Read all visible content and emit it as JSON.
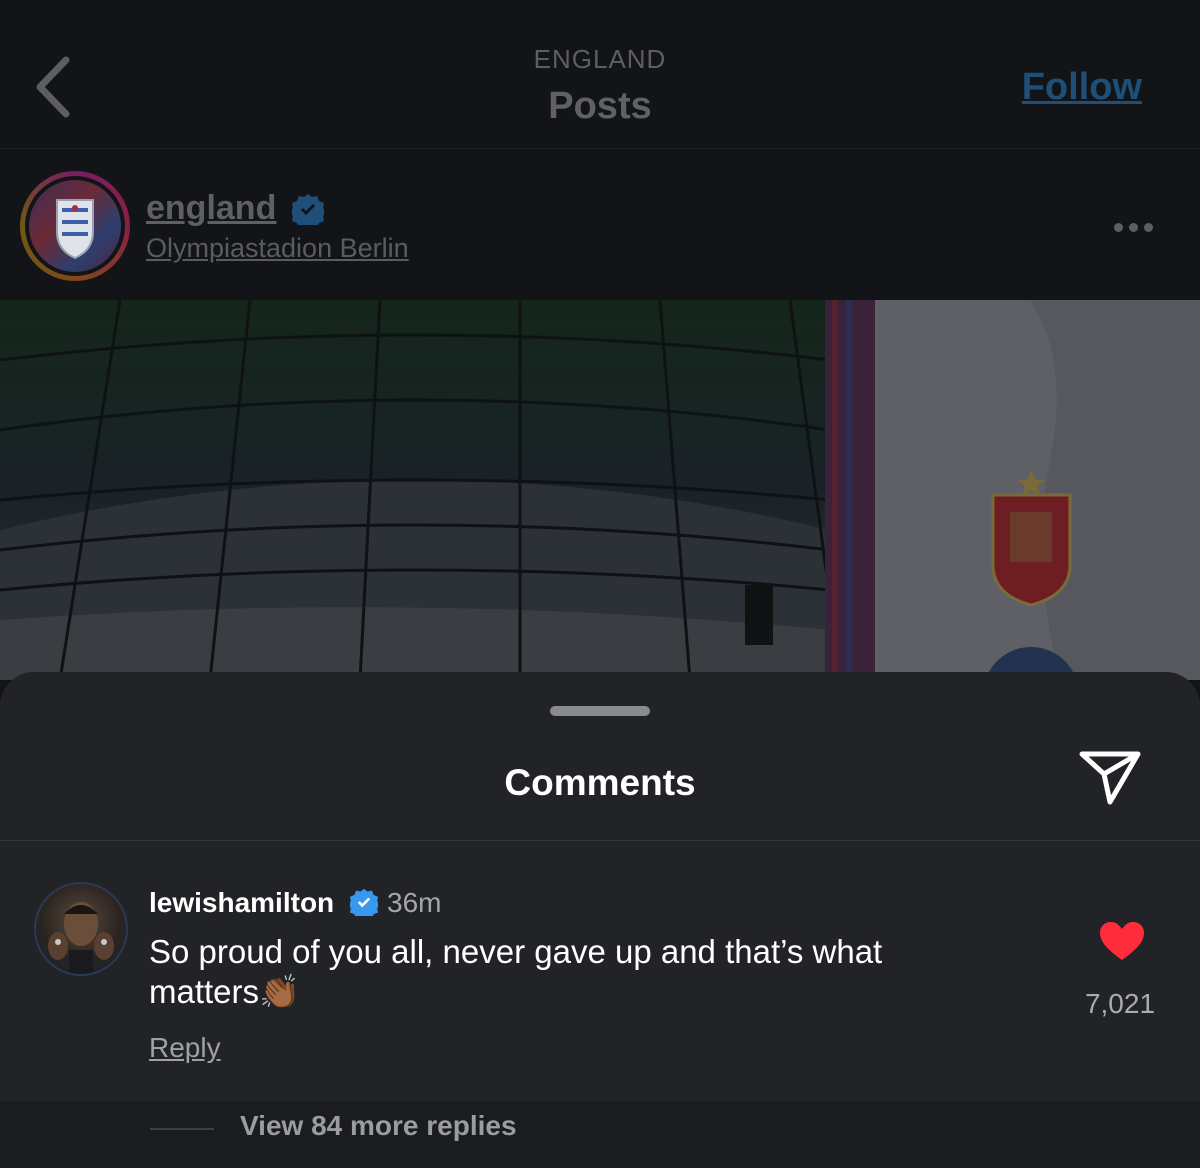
{
  "header": {
    "subtitle": "ENGLAND",
    "title": "Posts",
    "follow_label": "Follow",
    "back_icon": "chevron-left-icon"
  },
  "post": {
    "username": "england",
    "verified": true,
    "location": "Olympiastadion Berlin",
    "more_icon": "ellipsis-icon"
  },
  "comments_sheet": {
    "title": "Comments",
    "share_icon": "paper-plane-icon"
  },
  "comment": {
    "username": "lewishamilton",
    "verified": true,
    "time": "36m",
    "text": "So proud of you all, never gave up and that’s what matters👏🏾",
    "reply_label": "Reply",
    "like_count": "7,021",
    "liked": true,
    "like_color": "#ff2d3c"
  },
  "replies": {
    "label": "View 84 more replies"
  },
  "colors": {
    "sheet_bg": "#222326",
    "verified_blue": "#3897f0",
    "follow_blue": "#1d4f78"
  }
}
